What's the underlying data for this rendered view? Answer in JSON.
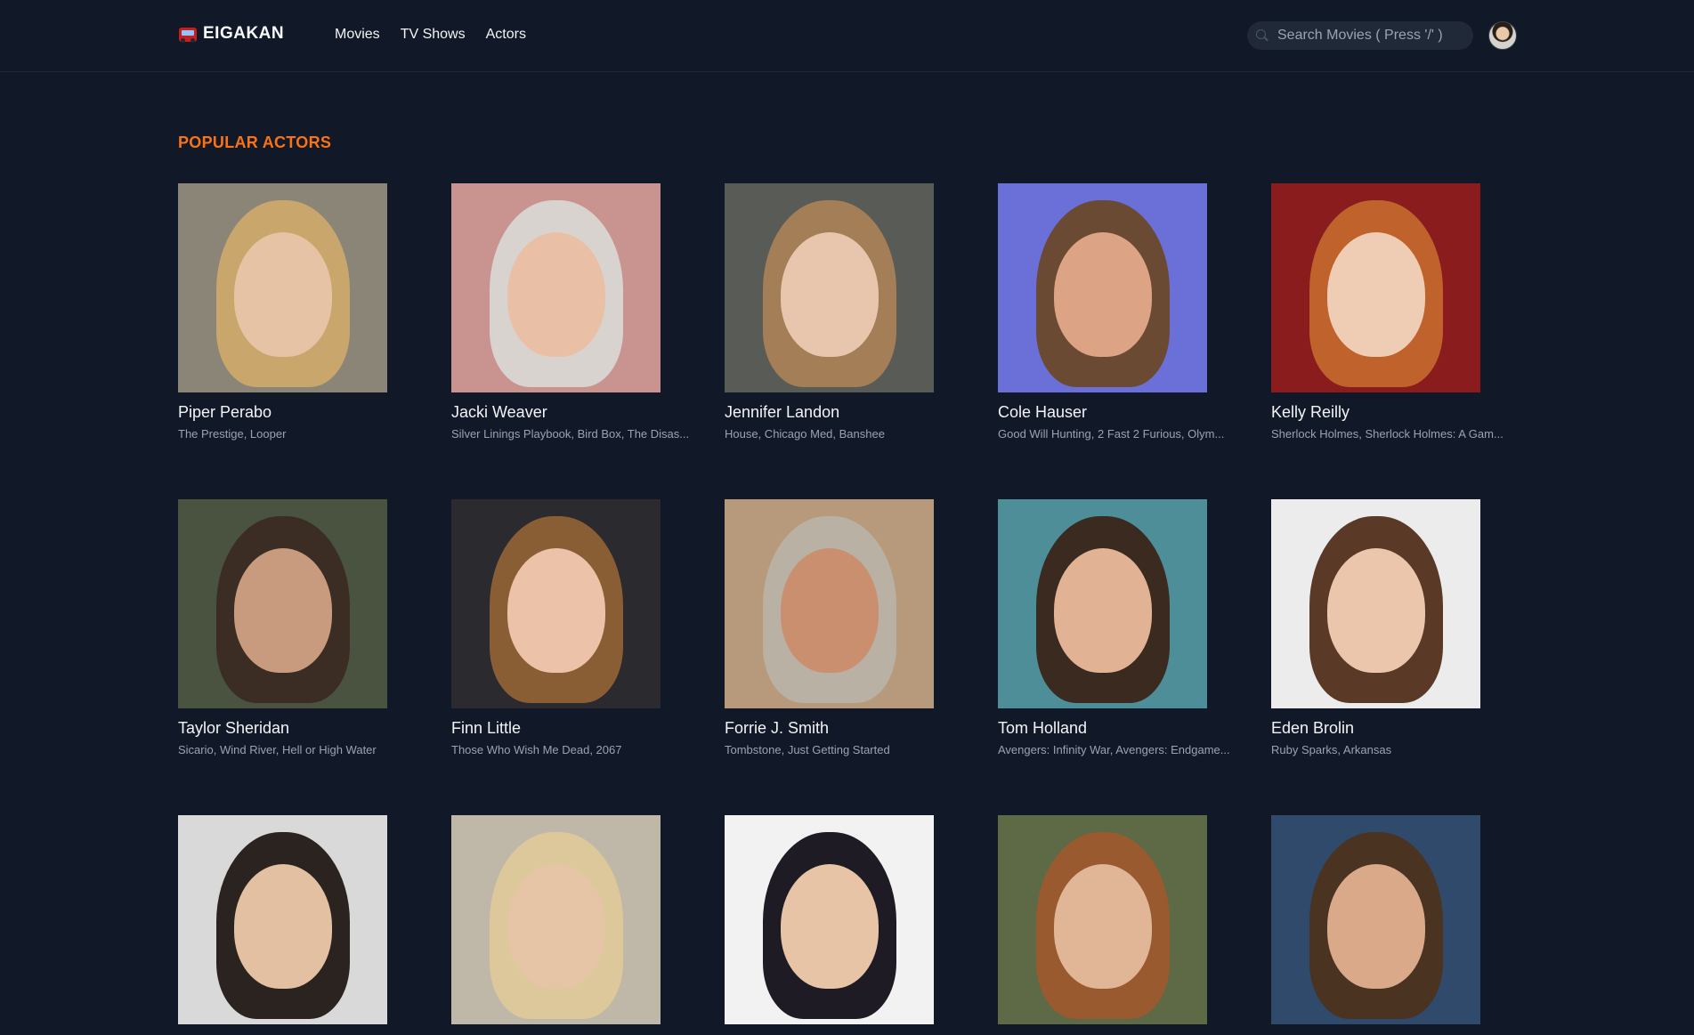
{
  "app": {
    "brand": "EIGAKAN",
    "nav": [
      "Movies",
      "TV Shows",
      "Actors"
    ],
    "search_placeholder": "Search Movies ( Press '/' )"
  },
  "section": {
    "title": "POPULAR ACTORS"
  },
  "actors": [
    {
      "name": "Piper Perabo",
      "known_for": "The Prestige, Looper",
      "bg": "#8b8578",
      "hair": "#c9a66b",
      "skin": "#e7c3a6"
    },
    {
      "name": "Jacki Weaver",
      "known_for": "Silver Linings Playbook, Bird Box, The Disas...",
      "bg": "#c9948f",
      "hair": "#d8d3cf",
      "skin": "#e9c0a6"
    },
    {
      "name": "Jennifer Landon",
      "known_for": "House, Chicago Med, Banshee",
      "bg": "#595b56",
      "hair": "#a47e56",
      "skin": "#e8c6ad"
    },
    {
      "name": "Cole Hauser",
      "known_for": "Good Will Hunting, 2 Fast 2 Furious, Olym...",
      "bg": "#6b6fd8",
      "hair": "#6b4a33",
      "skin": "#dca484"
    },
    {
      "name": "Kelly Reilly",
      "known_for": "Sherlock Holmes, Sherlock Holmes: A Gam...",
      "bg": "#8a1c1d",
      "hair": "#c0622c",
      "skin": "#efcdb5"
    },
    {
      "name": "Taylor Sheridan",
      "known_for": "Sicario, Wind River, Hell or High Water",
      "bg": "#4a5240",
      "hair": "#3b2d24",
      "skin": "#c89b7e"
    },
    {
      "name": "Finn Little",
      "known_for": "Those Who Wish Me Dead, 2067",
      "bg": "#2b2a2e",
      "hair": "#8a5e35",
      "skin": "#ecc2a8"
    },
    {
      "name": "Forrie J. Smith",
      "known_for": "Tombstone, Just Getting Started",
      "bg": "#b79a7b",
      "hair": "#b9b1a4",
      "skin": "#c98f6e"
    },
    {
      "name": "Tom Holland",
      "known_for": "Avengers: Infinity War, Avengers: Endgame...",
      "bg": "#4e8e99",
      "hair": "#3a2a20",
      "skin": "#e2b294"
    },
    {
      "name": "Eden Brolin",
      "known_for": "Ruby Sparks, Arkansas",
      "bg": "#ececec",
      "hair": "#5a3a27",
      "skin": "#ebc6ac"
    },
    {
      "name": "",
      "known_for": "",
      "bg": "#d9d9d9",
      "hair": "#2b2320",
      "skin": "#e4c0a3"
    },
    {
      "name": "",
      "known_for": "",
      "bg": "#bfb8a8",
      "hair": "#dcc89a",
      "skin": "#e6c5a6"
    },
    {
      "name": "",
      "known_for": "",
      "bg": "#f2f2f2",
      "hair": "#1e1b24",
      "skin": "#e8c4a6"
    },
    {
      "name": "",
      "known_for": "",
      "bg": "#5d6a45",
      "hair": "#9a5a30",
      "skin": "#e0b697"
    },
    {
      "name": "",
      "known_for": "",
      "bg": "#2f4a6a",
      "hair": "#4a3321",
      "skin": "#d9a98a"
    }
  ]
}
